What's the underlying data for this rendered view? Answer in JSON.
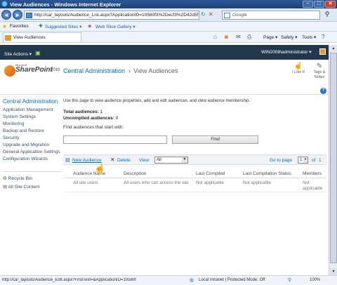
{
  "window": {
    "title": "View Audiences - Windows Internet Explorer"
  },
  "browser": {
    "url": "http://ca/_layouts/Audience_List.aspx?ApplicationID=10580f3%2Decf3%2D42d5f",
    "search_placeholder": "Google",
    "favorites": "Favorites",
    "suggested_sites": "Suggested Sites ▾",
    "web_slice_gallery": "Web Slice Gallery ▾",
    "tab_title": "View Audiences",
    "toolbar_page": "Page ▾",
    "toolbar_safety": "Safety ▾",
    "toolbar_tools": "Tools ▾"
  },
  "ribbon": {
    "site_actions": "Site Actions ▾",
    "user": "WIN2008\\administrator ▾"
  },
  "header": {
    "brand_small": "Microsoft",
    "brand": "SharePoint",
    "brand_year": "2010",
    "breadcrumb_root": "Central Administration",
    "breadcrumb_sep": "›",
    "breadcrumb_current": "View Audiences",
    "i_like_it": "I Like It",
    "tags_notes": "Tags & Notes"
  },
  "quicklaunch": {
    "heading": "Central Administration",
    "items": [
      "Application Management",
      "System Settings",
      "Monitoring",
      "Backup and Restore",
      "Security",
      "Upgrade and Migration",
      "General Application Settings",
      "Configuration Wizards"
    ],
    "recycle_bin": "Recycle Bin",
    "all_site_content": "All Site Content"
  },
  "main": {
    "intro": "Use this page to view audience properties, add and edit audiences, and view audience membership.",
    "total_label": "Total audiences:",
    "total_value": "1",
    "uncompiled_label": "Uncompiled audiences:",
    "uncompiled_value": "0",
    "find_label": "Find audiences that start with:",
    "find_button": "Find",
    "new_audience": "New Audience",
    "delete": "Delete",
    "view_label": "View:",
    "view_value": "All",
    "goto_label": "Go to page",
    "page_value": "1",
    "of_label": "of",
    "page_total": "1",
    "columns": [
      "Audience Name",
      "Description",
      "Last Compiled",
      "Last Compilation Status",
      "Members"
    ],
    "row": [
      "All site users",
      "All users who can access the site",
      "Not applicable",
      "Not applicable",
      "Not applicable"
    ]
  },
  "status": {
    "url": "http://ca/_layouts/Audience_Edit.aspx?FindText=&ApplicationID=10580f",
    "zone": "Local intranet | Protected Mode: Off",
    "zoom": "100%"
  }
}
